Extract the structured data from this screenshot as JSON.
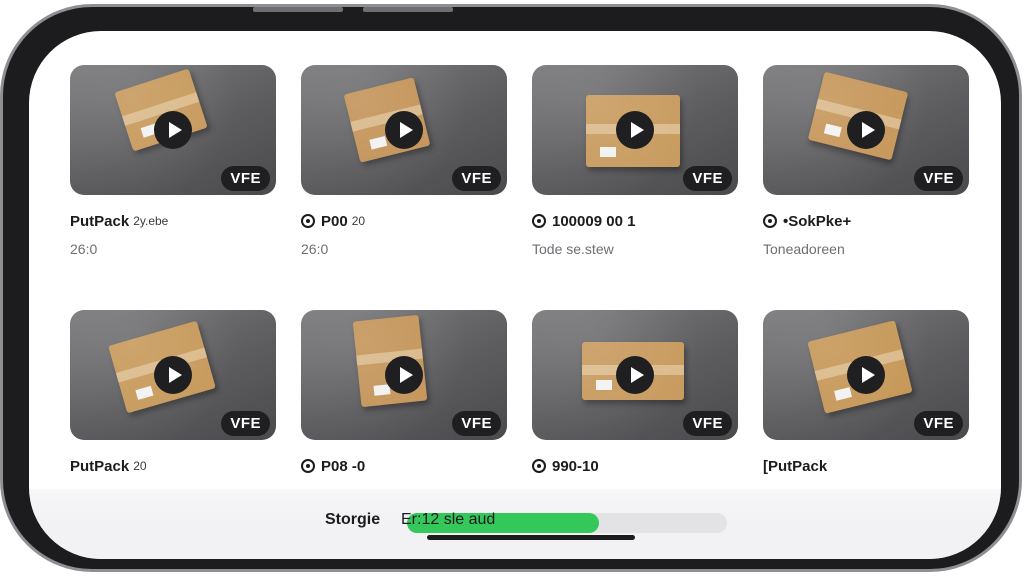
{
  "videos": [
    {
      "title": "PutPack",
      "title_extra": "2y.ebe",
      "has_icon": false,
      "subtitle": "26:0",
      "badge": "VFE"
    },
    {
      "title": "P00",
      "title_extra": "20",
      "has_icon": true,
      "subtitle": "26:0",
      "badge": "VFE"
    },
    {
      "title": "100009 00 1",
      "title_extra": "",
      "has_icon": true,
      "subtitle": "Tode se.stew",
      "badge": "VFE"
    },
    {
      "title": "•SokPke+",
      "title_extra": "",
      "has_icon": true,
      "subtitle": "Toneadoreen",
      "badge": "VFE"
    },
    {
      "title": "PutPack",
      "title_extra": "20",
      "has_icon": false,
      "subtitle": "",
      "badge": "VFE"
    },
    {
      "title": "P08 -0",
      "title_extra": "",
      "has_icon": true,
      "subtitle": "",
      "badge": "VFE"
    },
    {
      "title": "990-10",
      "title_extra": "",
      "has_icon": true,
      "subtitle": "",
      "badge": "VFE"
    },
    {
      "title": "[PutPack",
      "title_extra": "",
      "has_icon": false,
      "subtitle": "",
      "badge": "VFE"
    }
  ],
  "storage": {
    "label": "Storgie",
    "value_text": "Er:12 sle aud",
    "used_fraction": 0.6,
    "bar_color": "#34c759"
  },
  "icons": {
    "play": "play-icon",
    "title_icon": "location-pin-icon"
  }
}
